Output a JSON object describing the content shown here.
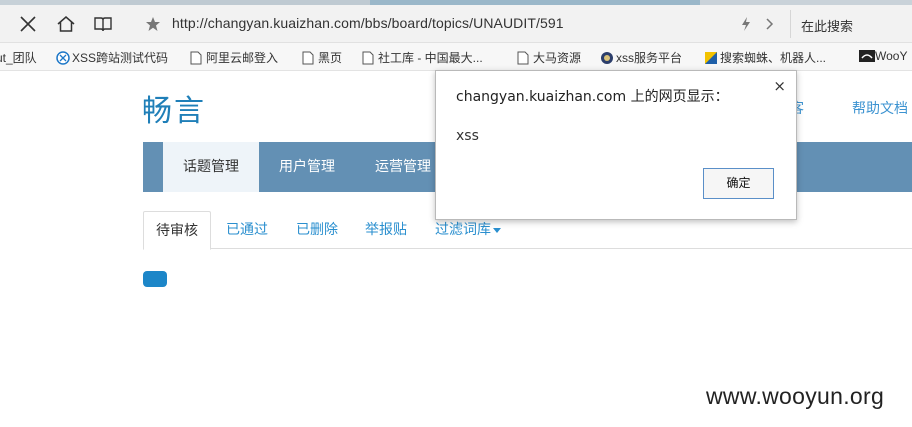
{
  "browser": {
    "url": "http://changyan.kuaizhan.com/bbs/board/topics/UNAUDIT/591",
    "search_placeholder": "在此搜索",
    "bookmarks": [
      {
        "label": "ut_团队",
        "icon": "none"
      },
      {
        "label": "XSS跨站测试代码",
        "icon": "xss-icon"
      },
      {
        "label": "阿里云邮登入",
        "icon": "page-icon"
      },
      {
        "label": "黑页",
        "icon": "page-icon"
      },
      {
        "label": "社工库 - 中国最大...",
        "icon": "page-icon"
      },
      {
        "label": "大马资源",
        "icon": "page-icon"
      },
      {
        "label": "xss服务平台",
        "icon": "cia-icon"
      },
      {
        "label": "搜索蜘蛛、机器人...",
        "icon": "shield-icon"
      },
      {
        "label": "WooY",
        "icon": "wooyun-icon"
      }
    ]
  },
  "page": {
    "logo": "畅言",
    "top_links": [
      "客",
      "帮助文档"
    ],
    "main_nav": [
      "话题管理",
      "用户管理",
      "运营管理"
    ],
    "sub_tabs": [
      "待审核",
      "已通过",
      "已删除",
      "举报贴",
      "过滤词库"
    ],
    "colors": {
      "nav_bg": "#6390b4",
      "link": "#2a8fcf",
      "button": "#1c86c8"
    }
  },
  "dialog": {
    "title": "changyan.kuaizhan.com 上的网页显示：",
    "close": "×",
    "message": "xss",
    "ok_label": "确定"
  },
  "watermark": "www.wooyun.org"
}
